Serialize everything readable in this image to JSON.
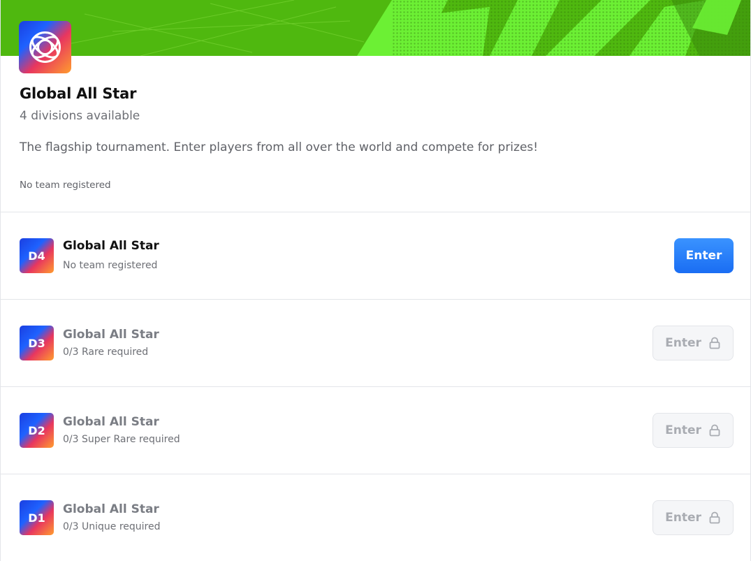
{
  "tournament": {
    "title": "Global All Star",
    "subtitle": "4 divisions available",
    "description": "The flagship tournament. Enter players from all over the world and compete for prizes!",
    "status": "No team registered",
    "icon": "tournament-globe-icon"
  },
  "colors": {
    "banner_green": "#6cf034",
    "banner_dark": "#4fb80f",
    "primary_button": "#1a6df3",
    "locked_button_bg": "#f5f6f8",
    "locked_text": "#a9acb2"
  },
  "divisions": [
    {
      "badge": "D4",
      "title": "Global All Star",
      "subtitle": "No team registered",
      "button": "Enter",
      "locked": false
    },
    {
      "badge": "D3",
      "title": "Global All Star",
      "subtitle": "0/3 Rare required",
      "button": "Enter",
      "locked": true
    },
    {
      "badge": "D2",
      "title": "Global All Star",
      "subtitle": "0/3 Super Rare required",
      "button": "Enter",
      "locked": true
    },
    {
      "badge": "D1",
      "title": "Global All Star",
      "subtitle": "0/3 Unique required",
      "button": "Enter",
      "locked": true
    }
  ]
}
